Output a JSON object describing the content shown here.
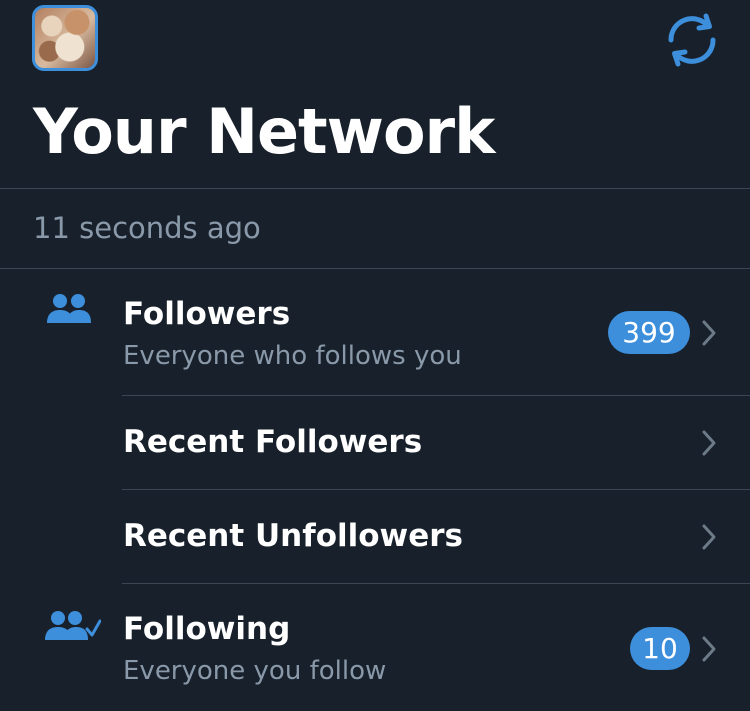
{
  "header": {
    "title": "Your Network",
    "avatar_icon": "profile-photo",
    "refresh_icon": "refresh-icon"
  },
  "status": {
    "updated": "11 seconds ago"
  },
  "rows": [
    {
      "icon": "people-icon",
      "title": "Followers",
      "subtitle": "Everyone who follows you",
      "count": "399"
    },
    {
      "title": "Recent Followers"
    },
    {
      "title": "Recent Unfollowers"
    },
    {
      "icon": "people-check-icon",
      "title": "Following",
      "subtitle": "Everyone you follow",
      "count": "10"
    }
  ],
  "colors": {
    "background": "#17202b",
    "accent": "#3d8fdc",
    "secondary_text": "#8a99a9",
    "separator": "#3a4653"
  }
}
